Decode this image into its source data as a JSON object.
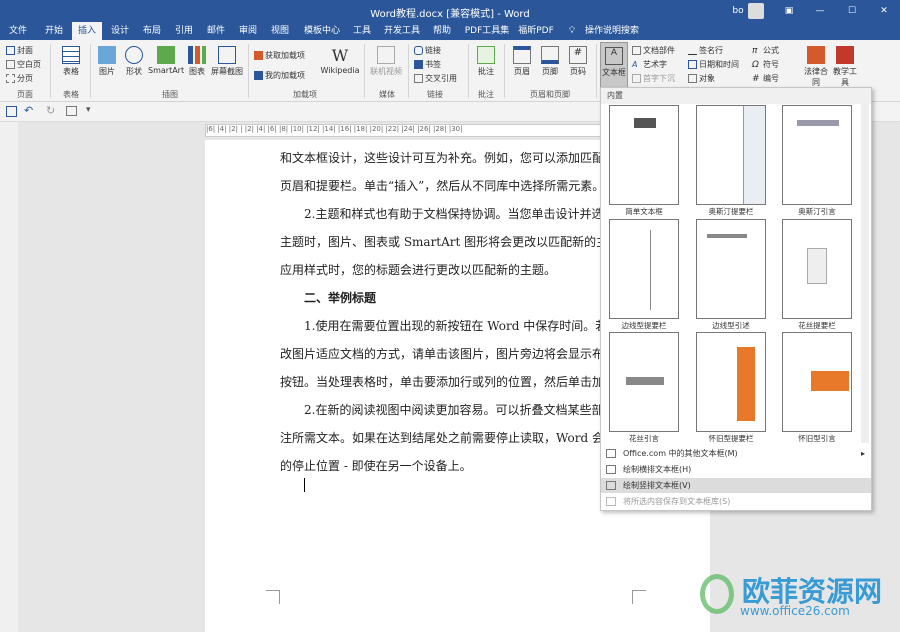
{
  "title": "Word教程.docx [兼容模式] - Word",
  "user": "bo",
  "tabs": [
    "文件",
    "开始",
    "插入",
    "设计",
    "布局",
    "引用",
    "邮件",
    "审阅",
    "视图",
    "模板中心",
    "工具",
    "开发工具",
    "帮助",
    "PDF工具集",
    "福昕PDF",
    "操作说明搜索"
  ],
  "ribbon": {
    "pages": [
      "封面",
      "空白页",
      "分页"
    ],
    "table": "表格",
    "pic": "图片",
    "shape": "形状",
    "smartart": "SmartArt",
    "chart": "图表",
    "screenshot": "屏幕截图",
    "get_addin": "获取加载项",
    "my_addin": "我的加载项",
    "wikipedia": "Wikipedia",
    "video": "联机视频",
    "link": "链接",
    "bookmark": "书签",
    "crossref": "交叉引用",
    "comment": "批注",
    "header": "页眉",
    "footer": "页脚",
    "pagenum": "页码",
    "textbox": "文本框",
    "docparts": "文档部件",
    "wordart": "艺术字",
    "dropcap": "首字下沉",
    "sigline": "签名行",
    "datetime": "日期和时间",
    "object": "对象",
    "formula": "公式",
    "symbol": "符号",
    "number": "编号",
    "legal": "法律合同",
    "teach": "教学工具",
    "groups": [
      "页面",
      "表格",
      "插图",
      "加载项",
      "媒体",
      "链接",
      "批注",
      "页眉和页脚"
    ]
  },
  "ruler": "|6| |4| |2| | |2| |4| |6| |8| |10| |12| |14| |16| |18| |20| |22| |24| |26| |28| |30|",
  "doc_lines": [
    "和文本框设计，这些设计可互为补充。例如，您可以添加匹配的封",
    "页眉和提要栏。单击“插入”，然后从不同库中选择所需元素。",
    "2.主题和样式也有助于文档保持协调。当您单击设计并选择",
    "主题时，图片、图表或 SmartArt 图形将会更改以匹配新的主题",
    "应用样式时，您的标题会进行更改以匹配新的主题。",
    "二、举例标题",
    "1.使用在需要位置出现的新按钮在 Word 中保存时间。若要",
    "改图片适应文档的方式，请单击该图片，图片旁边将会显示布局",
    "按钮。当处理表格时，单击要添加行或列的位置，然后单击加",
    "2.在新的阅读视图中阅读更加容易。可以折叠文档某些部分",
    "注所需文本。如果在达到结尾处之前需要停止读取，Word 会记",
    "的停止位置 - 即使在另一个设备上。"
  ],
  "dropdown": {
    "header": "内置",
    "thumbs": [
      "简单文本框",
      "奥斯汀提要栏",
      "奥斯汀引言",
      "边线型提要栏",
      "边线型引述",
      "花丝提要栏",
      "花丝引言",
      "怀旧型提要栏",
      "怀旧型引言"
    ],
    "menu": [
      "Office.com 中的其他文本框(M)",
      "绘制横排文本框(H)",
      "绘制竖排文本框(V)",
      "将所选内容保存到文本框库(S)"
    ]
  },
  "watermark": "欧菲资源网",
  "watermark_url": "www.office26.com",
  "colors": {
    "accent": "#2b579a",
    "orange": "#e8782a"
  }
}
